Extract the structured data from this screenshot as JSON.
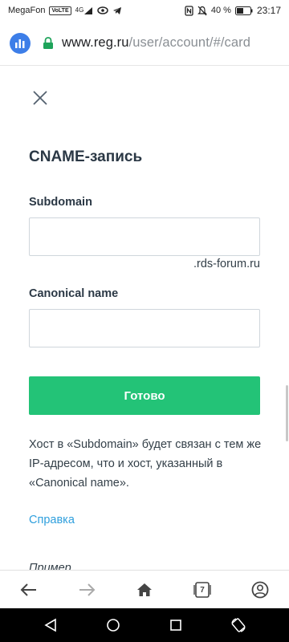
{
  "status_bar": {
    "carrier": "MegaFon",
    "network_badge": "VoLTE",
    "signal_label": "4G",
    "battery_percent": "40 %",
    "time": "23:17"
  },
  "browser": {
    "url_host": "www.reg.ru",
    "url_path": "/user/account/#/card",
    "tabs_count": "7"
  },
  "dialog": {
    "title": "CNAME-запись",
    "subdomain": {
      "label": "Subdomain",
      "value": "",
      "suffix": ".rds-forum.ru"
    },
    "canonical": {
      "label": "Canonical name",
      "value": ""
    },
    "submit_label": "Готово",
    "hint": "Хост в «Subdomain» будет связан с тем же IP-адресом, что и хост, указанный в «Canonical name».",
    "help_link": "Справка",
    "example_label": "Пример"
  },
  "colors": {
    "primary_button": "#23c377",
    "link": "#2f9fdd",
    "heading": "#2b3845",
    "site_icon": "#3d7ee8",
    "lock": "#1ea35a"
  },
  "icons": {
    "status": [
      "volte-icon",
      "signal-icon",
      "eye-icon",
      "telegram-icon",
      "nfc-icon",
      "mute-icon",
      "battery-icon"
    ],
    "browser": [
      "site-analytics-icon",
      "lock-icon"
    ],
    "toolbar": [
      "back-arrow-icon",
      "forward-arrow-icon",
      "home-icon",
      "tabs-icon",
      "profile-icon"
    ],
    "nav": [
      "nav-back-icon",
      "nav-home-icon",
      "nav-recents-icon",
      "rotate-icon"
    ]
  }
}
